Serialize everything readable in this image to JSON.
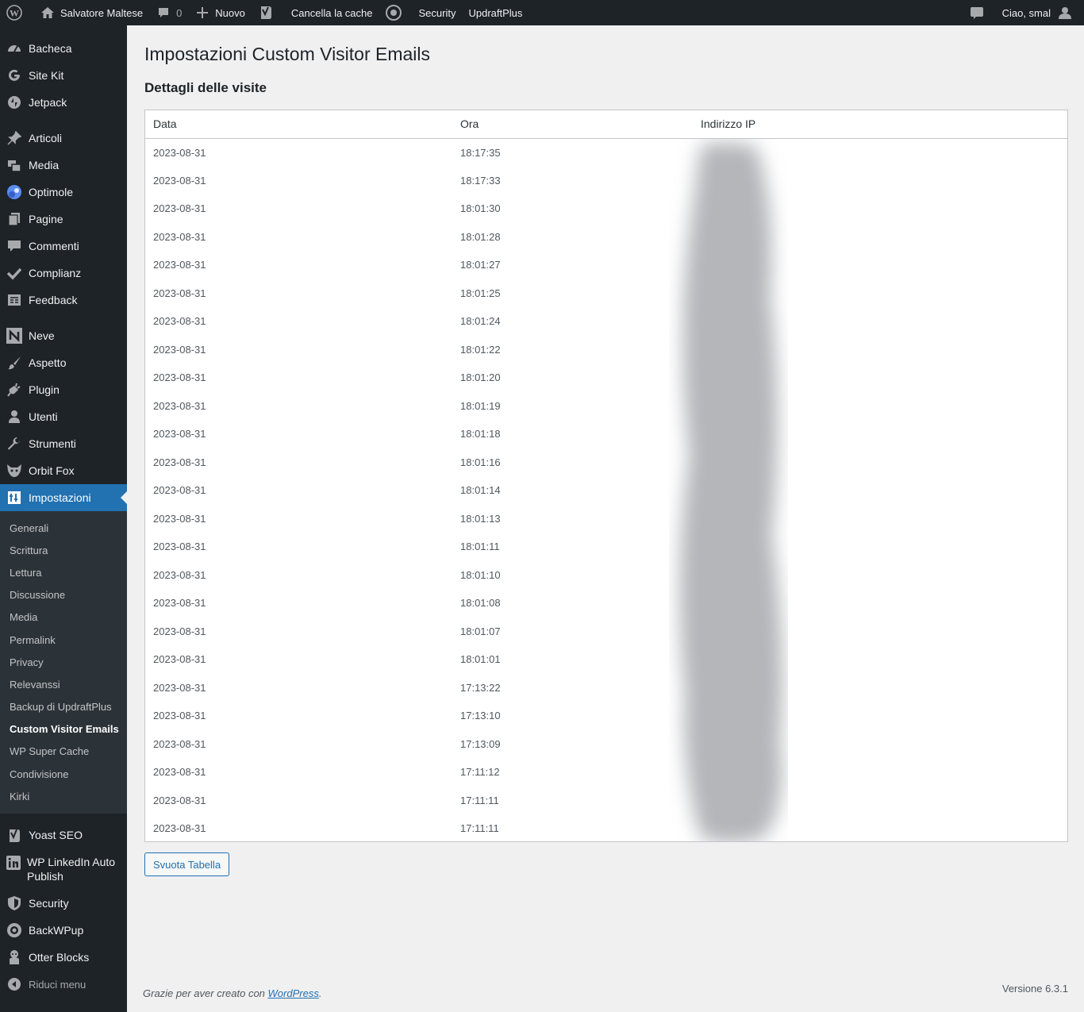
{
  "admin_bar": {
    "site_name": "Salvatore Maltese",
    "comments_count": "0",
    "new_label": "Nuovo",
    "clear_cache": "Cancella la cache",
    "security": "Security",
    "updraftplus": "UpdraftPlus",
    "greeting": "Ciao, smal"
  },
  "sidebar": {
    "group1": [
      {
        "label": "Bacheca",
        "icon": "dashboard-icon"
      },
      {
        "label": "Site Kit",
        "icon": "google-icon"
      },
      {
        "label": "Jetpack",
        "icon": "jetpack-icon"
      }
    ],
    "group2": [
      {
        "label": "Articoli",
        "icon": "pin-icon"
      },
      {
        "label": "Media",
        "icon": "media-icon"
      },
      {
        "label": "Optimole",
        "icon": "optimole-icon"
      },
      {
        "label": "Pagine",
        "icon": "page-icon"
      },
      {
        "label": "Commenti",
        "icon": "comment-icon"
      },
      {
        "label": "Complianz",
        "icon": "check-icon"
      },
      {
        "label": "Feedback",
        "icon": "feedback-icon"
      }
    ],
    "group3": [
      {
        "label": "Neve",
        "icon": "neve-icon"
      },
      {
        "label": "Aspetto",
        "icon": "brush-icon"
      },
      {
        "label": "Plugin",
        "icon": "plugin-icon"
      },
      {
        "label": "Utenti",
        "icon": "user-icon"
      },
      {
        "label": "Strumenti",
        "icon": "wrench-icon"
      },
      {
        "label": "Orbit Fox",
        "icon": "fox-icon"
      }
    ],
    "current": {
      "label": "Impostazioni",
      "icon": "settings-icon"
    },
    "submenu": [
      "Generali",
      "Scrittura",
      "Lettura",
      "Discussione",
      "Media",
      "Permalink",
      "Privacy",
      "Relevanssi",
      "Backup di UpdraftPlus",
      "Custom Visitor Emails",
      "WP Super Cache",
      "Condivisione",
      "Kirki"
    ],
    "submenu_current": "Custom Visitor Emails",
    "group4": [
      {
        "label": "Yoast SEO",
        "icon": "yoast-icon"
      },
      {
        "label": "WP LinkedIn Auto Publish",
        "icon": "linkedin-icon"
      },
      {
        "label": "Security",
        "icon": "shield-icon"
      },
      {
        "label": "BackWPup",
        "icon": "backwpup-icon"
      },
      {
        "label": "Otter Blocks",
        "icon": "otter-icon"
      }
    ],
    "collapse": "Riduci menu"
  },
  "page": {
    "title": "Impostazioni Custom Visitor Emails",
    "section_title": "Dettagli delle visite",
    "columns": [
      "Data",
      "Ora",
      "Indirizzo IP"
    ],
    "rows": [
      [
        "2023-08-31",
        "18:17:35"
      ],
      [
        "2023-08-31",
        "18:17:33"
      ],
      [
        "2023-08-31",
        "18:01:30"
      ],
      [
        "2023-08-31",
        "18:01:28"
      ],
      [
        "2023-08-31",
        "18:01:27"
      ],
      [
        "2023-08-31",
        "18:01:25"
      ],
      [
        "2023-08-31",
        "18:01:24"
      ],
      [
        "2023-08-31",
        "18:01:22"
      ],
      [
        "2023-08-31",
        "18:01:20"
      ],
      [
        "2023-08-31",
        "18:01:19"
      ],
      [
        "2023-08-31",
        "18:01:18"
      ],
      [
        "2023-08-31",
        "18:01:16"
      ],
      [
        "2023-08-31",
        "18:01:14"
      ],
      [
        "2023-08-31",
        "18:01:13"
      ],
      [
        "2023-08-31",
        "18:01:11"
      ],
      [
        "2023-08-31",
        "18:01:10"
      ],
      [
        "2023-08-31",
        "18:01:08"
      ],
      [
        "2023-08-31",
        "18:01:07"
      ],
      [
        "2023-08-31",
        "18:01:01"
      ],
      [
        "2023-08-31",
        "17:13:22"
      ],
      [
        "2023-08-31",
        "17:13:10"
      ],
      [
        "2023-08-31",
        "17:13:09"
      ],
      [
        "2023-08-31",
        "17:11:12"
      ],
      [
        "2023-08-31",
        "17:11:11"
      ],
      [
        "2023-08-31",
        "17:11:11"
      ]
    ],
    "empty_button": "Svuota Tabella"
  },
  "footer": {
    "thanks_prefix": "Grazie per aver creato con ",
    "wordpress_link": "WordPress",
    "thanks_suffix": ".",
    "version": "Versione 6.3.1"
  }
}
